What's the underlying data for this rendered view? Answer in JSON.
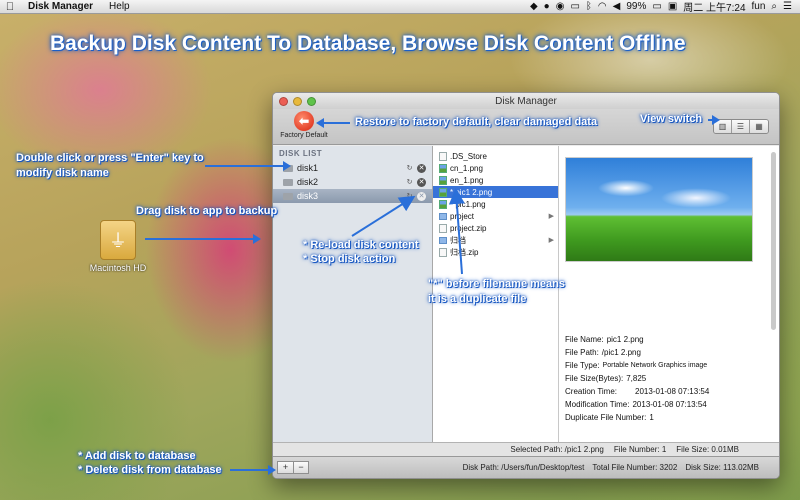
{
  "menubar": {
    "app_name": "Disk Manager",
    "help": "Help",
    "battery": "99%",
    "datetime": "周二 上午7:24",
    "user": "fun"
  },
  "banner": "Backup Disk Content To Database, Browse Disk Content Offline",
  "desktop": {
    "disk_label": "Macintosh HD"
  },
  "window": {
    "title": "Disk Manager",
    "factory_default_label": "Factory Default",
    "disk_list_header": "DISK LIST",
    "disks": [
      {
        "name": "disk1"
      },
      {
        "name": "disk2"
      },
      {
        "name": "disk3"
      }
    ],
    "files": [
      {
        "name": ".DS_Store",
        "type": "file"
      },
      {
        "name": "cn_1.png",
        "type": "image"
      },
      {
        "name": "en_1.png",
        "type": "image"
      },
      {
        "name": "* pic1 2.png",
        "type": "image",
        "selected": true
      },
      {
        "name": "* pic1.png",
        "type": "image"
      },
      {
        "name": "project",
        "type": "folder"
      },
      {
        "name": "project.zip",
        "type": "file"
      },
      {
        "name": "归档",
        "type": "folder"
      },
      {
        "name": "归档.zip",
        "type": "file"
      }
    ],
    "preview_meta": {
      "file_name_label": "File Name:",
      "file_name": "pic1 2.png",
      "file_path_label": "File Path:",
      "file_path": "/pic1 2.png",
      "file_type_label": "File Type:",
      "file_type": "Portable Network Graphics image",
      "file_size_label": "File Size(Bytes):",
      "file_size": "7,825",
      "creation_label": "Creation Time:",
      "creation": "2013-01-08 07:13:54",
      "modification_label": "Modification Time:",
      "modification": "2013-01-08 07:13:54",
      "duplicate_label": "Duplicate File Number:",
      "duplicate": "1"
    },
    "path_bar": {
      "selected_path": "Selected Path: /pic1 2.png",
      "file_number": "File Number: 1",
      "file_size": "File Size: 0.01MB"
    },
    "status_bar": {
      "add": "+",
      "remove": "−",
      "disk_path": "Disk Path: /Users/fun/Desktop/test",
      "total_files": "Total File Number: 3202",
      "disk_size": "Disk Size: 113.02MB"
    }
  },
  "callouts": {
    "restore": "Restore to factory default, clear damaged data",
    "view_switch": "View switch",
    "rename_line1": "Double click or press \"Enter\" key to",
    "rename_line2": "modify disk name",
    "drag": "Drag disk to app to backup",
    "reload": "* Re-load disk content",
    "stop": "* Stop disk action",
    "dup_line1": "\"*\" before filename means",
    "dup_line2": "it is a duplicate file",
    "add_disk": "* Add disk to database",
    "delete_disk": "* Delete disk from database"
  }
}
